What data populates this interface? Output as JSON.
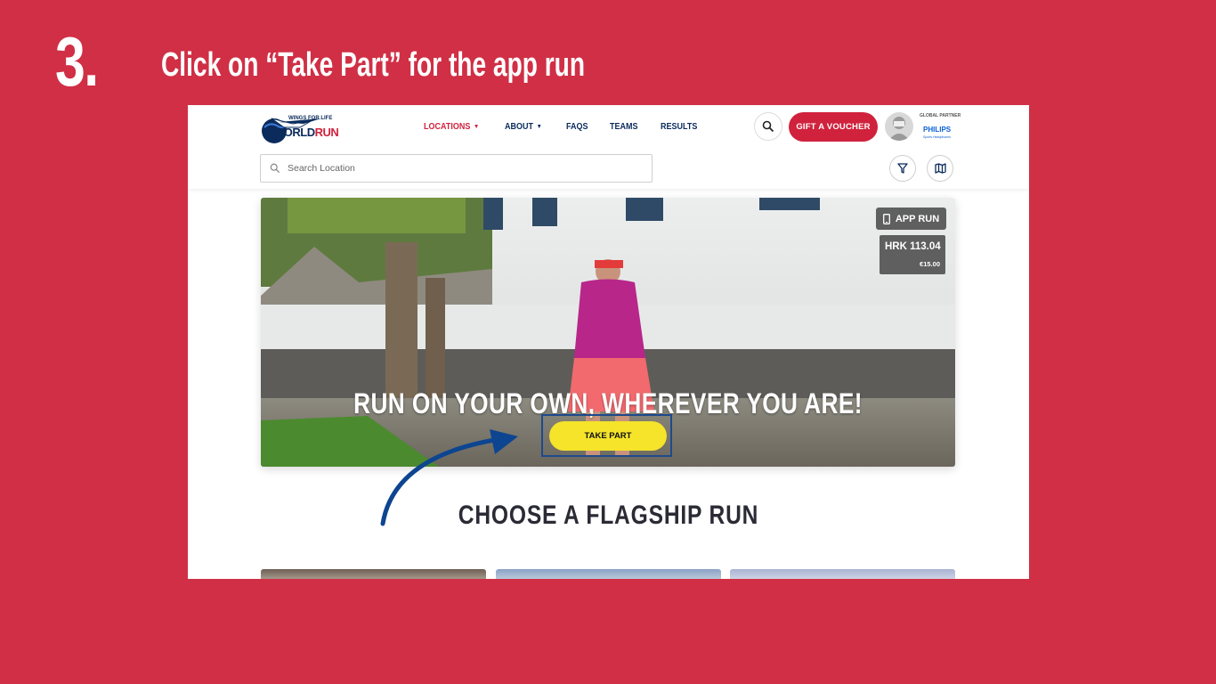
{
  "step": {
    "number": "3.",
    "title": "Click on “Take Part” for the app run"
  },
  "header": {
    "logo": {
      "top_text": "WINGS FOR LIFE",
      "line1": "WORLD",
      "line2": "RUN"
    },
    "nav": [
      {
        "label": "LOCATIONS",
        "has_dropdown": true,
        "active": true
      },
      {
        "label": "ABOUT",
        "has_dropdown": true,
        "active": false
      },
      {
        "label": "FAQS",
        "has_dropdown": false,
        "active": false
      },
      {
        "label": "TEAMS",
        "has_dropdown": false,
        "active": false
      },
      {
        "label": "RESULTS",
        "has_dropdown": false,
        "active": false
      }
    ],
    "gift_button": "GIFT A VOUCHER",
    "partner": {
      "label": "GLOBAL PARTNER",
      "name": "PHILIPS",
      "sub": "Sports Headphones"
    }
  },
  "search": {
    "placeholder": "Search Location"
  },
  "hero": {
    "badge": "APP RUN",
    "price_main": "HRK 113.04",
    "price_sub": "€15.00",
    "title": "RUN ON YOUR OWN, WHEREVER YOU ARE!",
    "cta": "TAKE PART"
  },
  "section": {
    "title": "CHOOSE A FLAGSHIP RUN"
  },
  "colors": {
    "background": "#d02f45",
    "brand_red": "#d0223d",
    "brand_navy": "#0a2b5c",
    "cta_yellow": "#f5e42a",
    "highlight": "#1d4a8c"
  },
  "icons": [
    "search-icon",
    "chevron-down-icon",
    "filter-icon",
    "map-icon",
    "phone-icon",
    "arrow-icon"
  ]
}
